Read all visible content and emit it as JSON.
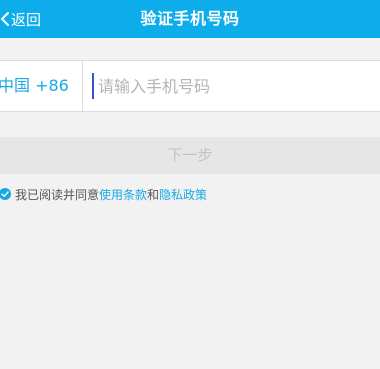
{
  "nav": {
    "back_label": "返回",
    "title": "验证手机号码"
  },
  "phone": {
    "country_code": "中国 +86",
    "placeholder": "请输入手机号码"
  },
  "next_button": {
    "label": "下一步"
  },
  "agreement": {
    "prefix": "我已阅读并同意",
    "terms_link": "使用条款",
    "conjunction": "和",
    "privacy_link": "隐私政策",
    "checked": true
  },
  "colors": {
    "accent": "#0daceb",
    "link": "#17a9e6",
    "background": "#f2f2f2",
    "button_disabled": "#e6e6e6"
  },
  "icons": {
    "back": "chevron-left-icon",
    "agree": "check-circle-icon"
  }
}
